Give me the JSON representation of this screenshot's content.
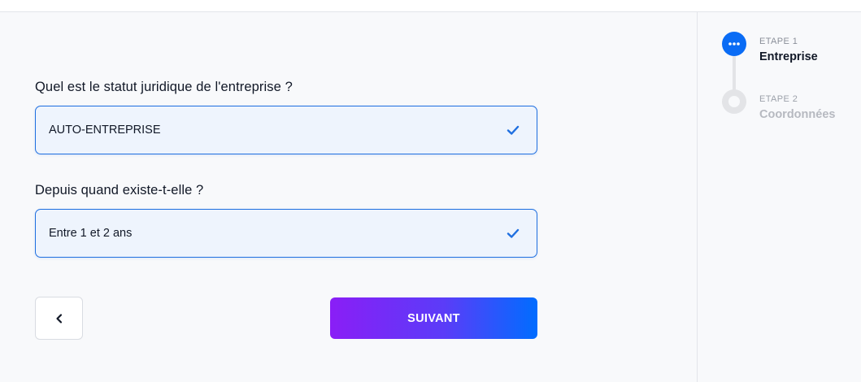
{
  "form": {
    "question_1": "Quel est le statut juridique de l'entreprise ?",
    "answer_1": "AUTO-ENTREPRISE",
    "question_2": "Depuis quand existe-t-elle ?",
    "answer_2": "Entre 1 et 2 ans"
  },
  "nav": {
    "next_label": "SUIVANT"
  },
  "steps": [
    {
      "number": "ETAPE 1",
      "title": "Entreprise",
      "status": "active"
    },
    {
      "number": "ETAPE 2",
      "title": "Coordonnées",
      "status": "pending"
    }
  ],
  "icons": {
    "check": "check-icon",
    "back": "chevron-left-icon",
    "active_step": "ellipsis-icon"
  },
  "colors": {
    "accent": "#0a6cf5",
    "selected_border": "#1f6fe0",
    "selected_bg": "#eef4fd",
    "gradient_start": "#8a1ef6",
    "gradient_end": "#006dff"
  }
}
